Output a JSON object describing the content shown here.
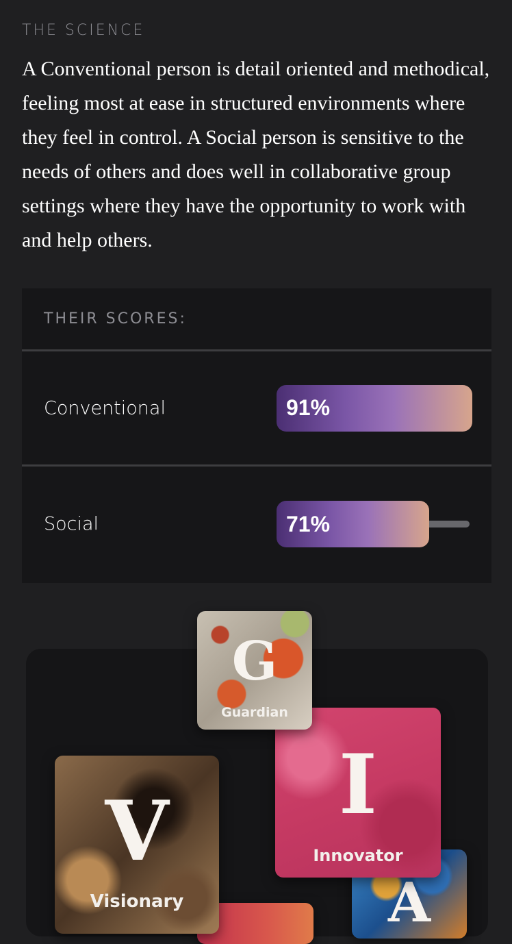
{
  "science": {
    "label": "THE SCIENCE",
    "text": "A Conventional person is detail oriented and methodical, feeling most at ease in structured environments where they feel in control. A Social person is sensitive to the needs of others and does well in collaborative group settings where they have the opportunity to work with and help others."
  },
  "scores": {
    "header": "THEIR SCORES:",
    "items": [
      {
        "label": "Conventional",
        "value_text": "91%",
        "value": 91
      },
      {
        "label": "Social",
        "value_text": "71%",
        "value": 71
      }
    ]
  },
  "cards": {
    "guardian": {
      "letter": "G",
      "name": "Guardian"
    },
    "innovator": {
      "letter": "I",
      "name": "Innovator"
    },
    "visionary": {
      "letter": "V",
      "name": "Visionary"
    },
    "a_card": {
      "letter": "A"
    }
  }
}
